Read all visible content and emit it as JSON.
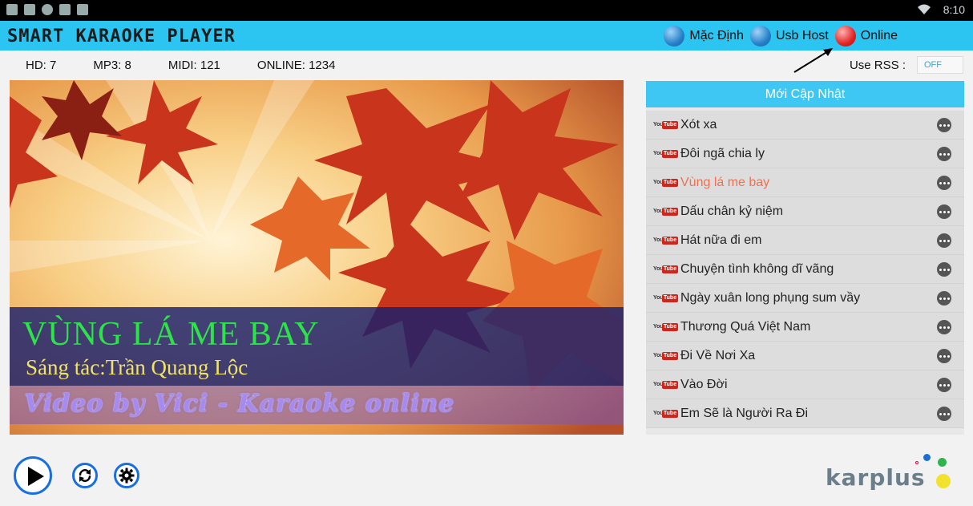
{
  "status_bar": {
    "time": "8:10",
    "left_icons": [
      "screenshot-icon",
      "gmail-icon",
      "sync-icon",
      "signal-bars-icon",
      "sim-icon"
    ],
    "right_icons": [
      "wifi-icon"
    ]
  },
  "titlebar": {
    "app_title": "SMART KARAOKE PLAYER",
    "modes": [
      {
        "label": "Mặc Định",
        "active": false
      },
      {
        "label": "Usb Host",
        "active": false
      },
      {
        "label": "Online",
        "active": true
      }
    ]
  },
  "info": {
    "stats": [
      {
        "label": "HD: 7"
      },
      {
        "label": "MP3: 8"
      },
      {
        "label": "MIDI: 121"
      },
      {
        "label": "ONLINE: 1234"
      }
    ],
    "rss_label": "Use RSS :",
    "rss_value": "OFF"
  },
  "video": {
    "song_title": "VÙNG LÁ ME BAY",
    "composer": "Sáng tác:Trần Quang Lộc",
    "credit": "Video by Vici - Karaoke online"
  },
  "playlist": {
    "header": "Mới Cập Nhật",
    "items": [
      {
        "title": "Xót xa",
        "playing": false
      },
      {
        "title": "Đôi ngã chia ly",
        "playing": false
      },
      {
        "title": "Vùng lá me bay",
        "playing": true
      },
      {
        "title": "Dấu chân kỷ niệm",
        "playing": false
      },
      {
        "title": "Hát nữa đi em",
        "playing": false
      },
      {
        "title": "Chuyện tình không dĩ vãng",
        "playing": false
      },
      {
        "title": "Ngày xuân long phụng sum vầy",
        "playing": false
      },
      {
        "title": "Thương Quá Việt Nam",
        "playing": false
      },
      {
        "title": "Đi Về Nơi Xa",
        "playing": false
      },
      {
        "title": "Vào Đời",
        "playing": false
      },
      {
        "title": "Em Sẽ là Người Ra Đi",
        "playing": false
      }
    ],
    "youtube_badge": {
      "you": "You",
      "tube": "Tube"
    }
  },
  "controls": [
    "play-button",
    "repeat-button",
    "settings-button"
  ],
  "logo": {
    "text": "karplus"
  },
  "colors": {
    "titlebar": "#2cc4f0",
    "playlist_header": "#3ec7f2",
    "active_mode": "#e22424",
    "playing_item": "#f07050",
    "song_title": "#2ee24b",
    "composer": "#f0e36a"
  }
}
